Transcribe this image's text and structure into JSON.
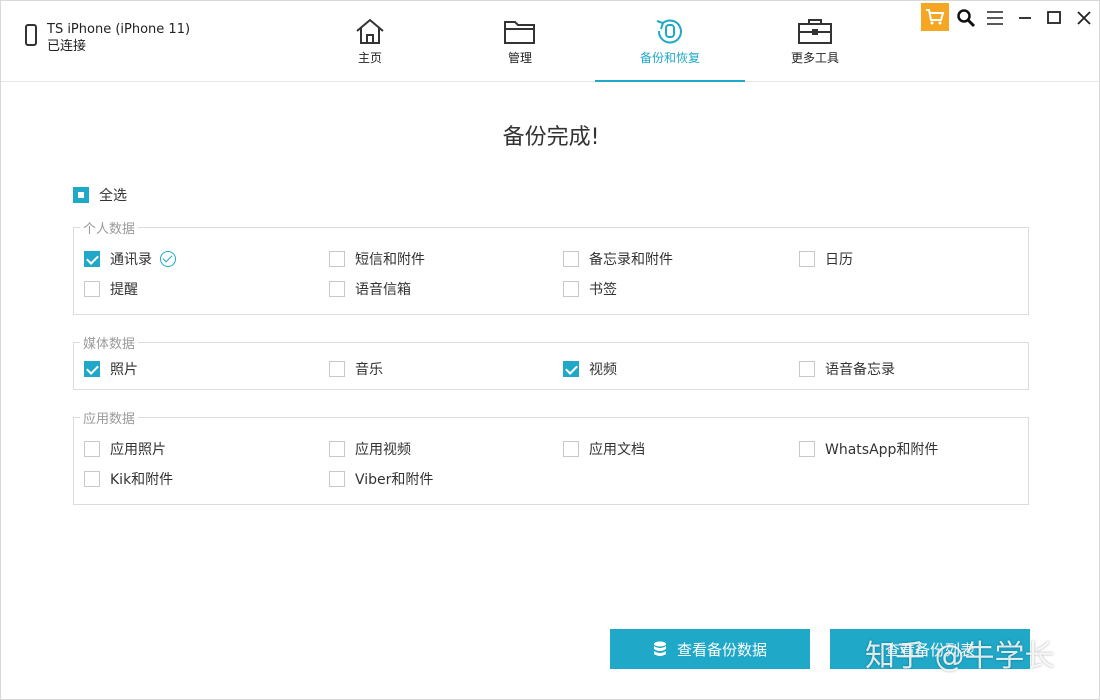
{
  "device": {
    "name": "TS iPhone (iPhone 11)",
    "status": "已连接"
  },
  "nav": {
    "home": "主页",
    "manage": "管理",
    "backup": "备份和恢复",
    "tools": "更多工具"
  },
  "title": "备份完成!",
  "select_all": "全选",
  "groups": {
    "personal": {
      "title": "个人数据",
      "items": [
        "通讯录",
        "短信和附件",
        "备忘录和附件",
        "日历",
        "提醒",
        "语音信箱",
        "书签"
      ]
    },
    "media": {
      "title": "媒体数据",
      "items": [
        "照片",
        "音乐",
        "视频",
        "语音备忘录"
      ]
    },
    "apps": {
      "title": "应用数据",
      "items": [
        "应用照片",
        "应用视频",
        "应用文档",
        "WhatsApp和附件",
        "Kik和附件",
        "Viber和附件"
      ]
    }
  },
  "buttons": {
    "view_backup": "查看备份数据",
    "backup_list": "查看备份列表"
  },
  "watermark": "知乎 @牛学长",
  "colors": {
    "accent": "#1fa8c8",
    "cart": "#f5a623"
  }
}
